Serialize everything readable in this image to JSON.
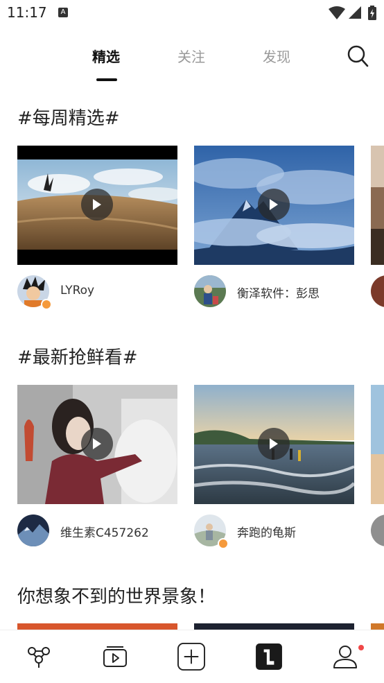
{
  "status_bar": {
    "time": "11:17",
    "notification_icon": "A"
  },
  "tabs": [
    {
      "label": "精选",
      "active": true
    },
    {
      "label": "关注",
      "active": false
    },
    {
      "label": "发现",
      "active": false
    }
  ],
  "sections": [
    {
      "title": "#每周精选#",
      "cards": [
        {
          "author": "LYRoy",
          "avatar_badge": true,
          "icon": "play-icon"
        },
        {
          "author": "衡泽软件：彭思",
          "avatar_badge": false,
          "icon": "play-icon"
        }
      ]
    },
    {
      "title": "#最新抢鲜看#",
      "cards": [
        {
          "author": "维生素C457262",
          "avatar_badge": false,
          "icon": "play-icon"
        },
        {
          "author": "奔跑的龟斯",
          "avatar_badge": true,
          "icon": "play-icon"
        }
      ]
    },
    {
      "title": "你想象不到的世界景象！"
    }
  ],
  "bottom_nav": [
    {
      "icon": "discover-icon"
    },
    {
      "icon": "video-icon"
    },
    {
      "icon": "add-icon"
    },
    {
      "icon": "brand-icon"
    },
    {
      "icon": "profile-icon",
      "notification": true
    }
  ],
  "colors": {
    "accent": "#111111",
    "inactive_tab": "#999999",
    "badge": "#f59a3c",
    "notification": "#f04848"
  }
}
